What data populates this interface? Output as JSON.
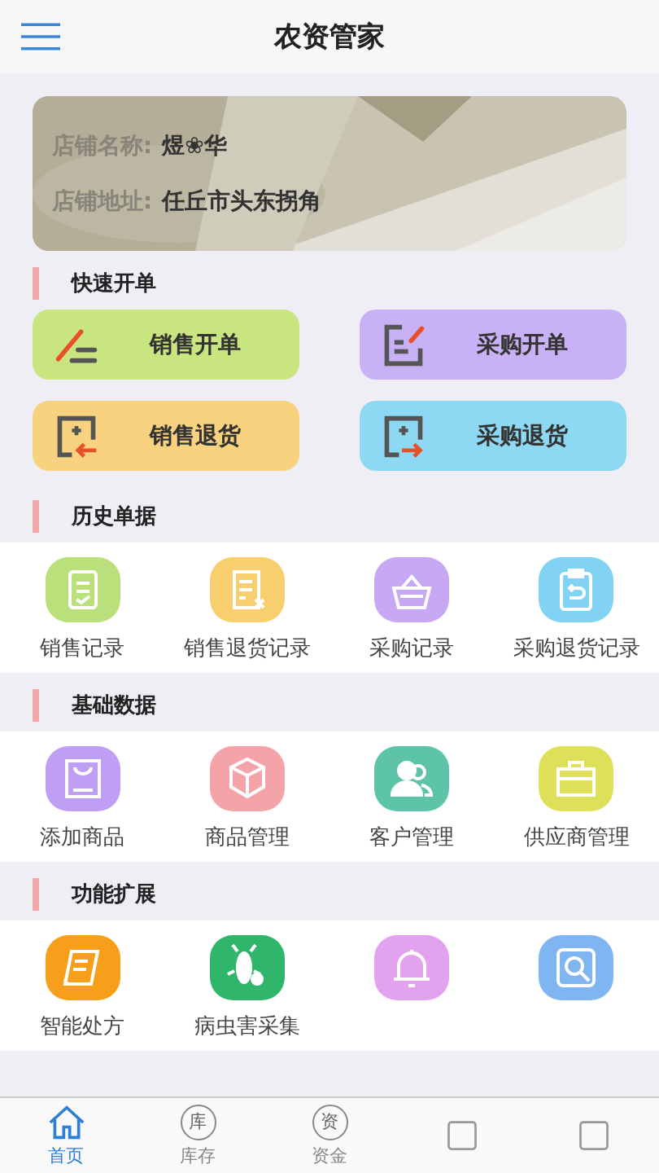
{
  "header": {
    "title": "农资管家"
  },
  "store": {
    "name_label": "店铺名称:",
    "name": "煜❀华",
    "address_label": "店铺地址:",
    "address": "任丘市头东拐角"
  },
  "quick": {
    "title": "快速开单",
    "buttons": [
      {
        "label": "销售开单",
        "color": "#c9e57f"
      },
      {
        "label": "采购开单",
        "color": "#c9b1f5"
      },
      {
        "label": "销售退货",
        "color": "#f8d27e"
      },
      {
        "label": "采购退货",
        "color": "#8dd8f2"
      }
    ]
  },
  "sections": [
    {
      "title": "历史单据",
      "items": [
        {
          "label": "销售记录",
          "color": "#b9e07a"
        },
        {
          "label": "销售退货记录",
          "color": "#f8cf6e"
        },
        {
          "label": "采购记录",
          "color": "#c6a9f2"
        },
        {
          "label": "采购退货记录",
          "color": "#82d3f3"
        }
      ]
    },
    {
      "title": "基础数据",
      "items": [
        {
          "label": "添加商品",
          "color": "#bf9ff3"
        },
        {
          "label": "商品管理",
          "color": "#f4a4a8"
        },
        {
          "label": "客户管理",
          "color": "#5ec4a8"
        },
        {
          "label": "供应商管理",
          "color": "#dfe05a"
        }
      ]
    },
    {
      "title": "功能扩展",
      "items": [
        {
          "label": "智能处方",
          "color": "#f79e1b"
        },
        {
          "label": "病虫害采集",
          "color": "#2fb66a"
        },
        {
          "color": "#e2a2ee"
        },
        {
          "color": "#7fb5f0"
        }
      ]
    }
  ],
  "tabbar": [
    {
      "label": "首页",
      "selected": true
    },
    {
      "label": "库存",
      "glyph": "库",
      "selected": false
    },
    {
      "label": "资金",
      "glyph": "资",
      "selected": false
    },
    {
      "selected": false
    },
    {
      "selected": false
    }
  ]
}
